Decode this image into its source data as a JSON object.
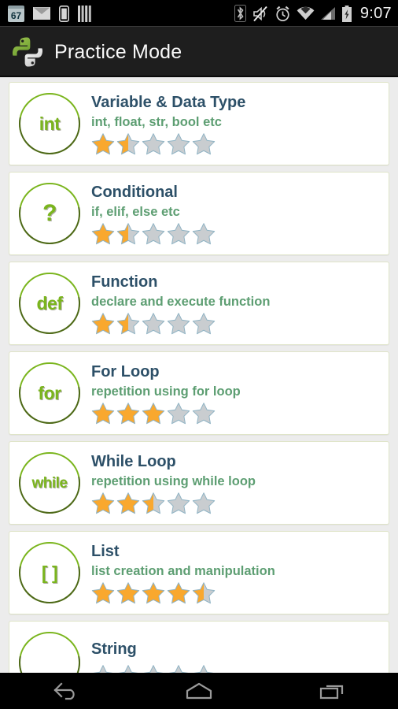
{
  "status_bar": {
    "calendar_badge": "67",
    "time": "9:07",
    "left_icons": [
      "calendar-icon",
      "email-icon",
      "phone-icon",
      "barcode-icon"
    ],
    "right_icons": [
      "bluetooth-icon",
      "mute-icon",
      "alarm-icon",
      "wifi-icon",
      "cellular-signal-icon",
      "battery-charging-icon"
    ]
  },
  "action_bar": {
    "title": "Practice Mode",
    "logo": "python-logo"
  },
  "colors": {
    "title_text": "#2d5068",
    "subtitle_text": "#5d9e72",
    "icon_green": "#7ab51d",
    "star_filled": "#f9a82e",
    "star_empty": "#c9cdd0",
    "card_border": "#dfe4c8",
    "list_background": "#ececec",
    "action_bar": "#1e1e1e"
  },
  "lessons": [
    {
      "icon": "int",
      "icon_size": "normal",
      "title": "Variable & Data Type",
      "subtitle": "int, float, str, bool etc",
      "rating": 1.5
    },
    {
      "icon": "?",
      "icon_size": "big",
      "title": "Conditional",
      "subtitle": "if, elif, else etc",
      "rating": 1.5
    },
    {
      "icon": "def",
      "icon_size": "normal",
      "title": "Function",
      "subtitle": "declare and execute function",
      "rating": 1.5
    },
    {
      "icon": "for",
      "icon_size": "normal",
      "title": "For Loop",
      "subtitle": "repetition using for loop",
      "rating": 3.0
    },
    {
      "icon": "while",
      "icon_size": "small",
      "title": "While Loop",
      "subtitle": "repetition using while loop",
      "rating": 2.5
    },
    {
      "icon": "[ ]",
      "icon_size": "normal",
      "title": "List",
      "subtitle": "list creation and manipulation",
      "rating": 4.5
    },
    {
      "icon": "",
      "icon_size": "normal",
      "title": "String",
      "subtitle": "",
      "rating": 0
    }
  ],
  "nav_bar": {
    "buttons": [
      "back-button",
      "home-button",
      "recents-button"
    ]
  }
}
